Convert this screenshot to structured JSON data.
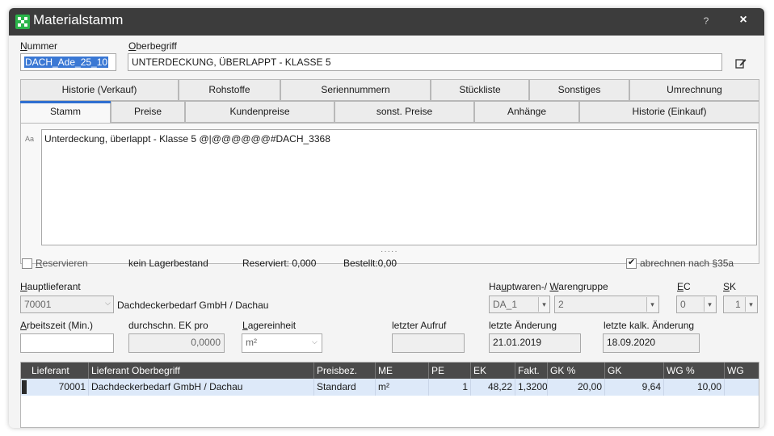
{
  "window": {
    "title": "Materialstamm",
    "help": "?",
    "close": "×"
  },
  "header": {
    "nummer_label_u": "N",
    "nummer_label_rest": "ummer",
    "nummer_value": "DACH_Ade_25_10",
    "oberbegriff_label_u": "O",
    "oberbegriff_label_rest": "berbegriff",
    "oberbegriff_value": "UNTERDECKUNG, ÜBERLAPPT - KLASSE 5"
  },
  "tabs_row1": [
    "Historie (Verkauf)",
    "Rohstoffe",
    "Seriennummern",
    "Stückliste",
    "Sonstiges",
    "Umrechnung"
  ],
  "tabs_row2": [
    "Stamm",
    "Preise",
    "Kundenpreise",
    "sonst. Preise",
    "Anhänge",
    "Historie (Einkauf)"
  ],
  "stamm": {
    "aa_icon": "Aa",
    "description": "Unterdeckung, überlappt - Klasse 5 @|@@@@@@#DACH_3368",
    "dots": "·····"
  },
  "status": {
    "reservieren_u": "R",
    "reservieren_rest": "eservieren",
    "lagerbestand": "kein Lagerbestand",
    "reserviert": "Reserviert: 0,000",
    "bestellt": "Bestellt:0,00",
    "abrechnen": "abrechnen nach §35a"
  },
  "hauptlieferant": {
    "label_u": "H",
    "label_rest": "auptlieferant",
    "number": "70001",
    "name": "Dachdeckerbedarf GmbH / Dachau"
  },
  "warengruppe": {
    "label_part1_a": "Ha",
    "label_part1_u": "u",
    "label_part1_b": "ptwaren-/",
    "label_part2_u": "W",
    "label_part2_rest": "arengruppe",
    "haupt_value": "DA_1",
    "waren_value": "2"
  },
  "ec": {
    "label_u": "E",
    "label_rest": "C",
    "value": "0"
  },
  "sk": {
    "label_u": "S",
    "label_rest": "K",
    "value": "1"
  },
  "arbeitszeit": {
    "label_u": "A",
    "label_rest": "rbeitszeit (Min.)",
    "value": ""
  },
  "ek_pro": {
    "label": "durchschn. EK pro",
    "value": "0,0000"
  },
  "lagereinheit": {
    "label_u": "L",
    "label_rest": "agereinheit",
    "value": "m²"
  },
  "letzter_aufruf": {
    "label": "letzter Aufruf",
    "value": ""
  },
  "letzte_aenderung": {
    "label": "letzte Änderung",
    "value": "21.01.2019"
  },
  "letzte_kalk": {
    "label": "letzte kalk. Änderung",
    "value": "18.09.2020"
  },
  "grid": {
    "columns": [
      "Lieferant",
      "Lieferant Oberbegriff",
      "Preisbez.",
      "ME",
      "PE",
      "EK",
      "Fakt.",
      "GK %",
      "GK",
      "WG %",
      "WG"
    ],
    "rows": [
      [
        "70001",
        "Dachdeckerbedarf GmbH / Dachau",
        "Standard",
        "m²",
        "1",
        "48,22",
        "1,3200",
        "20,00",
        "9,64",
        "10,00",
        ""
      ]
    ]
  },
  "colors": {
    "titlebar": "#3c3c3c",
    "accent": "#2f6fd0",
    "selection": "#3a78d4",
    "grid_header": "#4a4a4a",
    "grid_row": "#dde9f9"
  }
}
